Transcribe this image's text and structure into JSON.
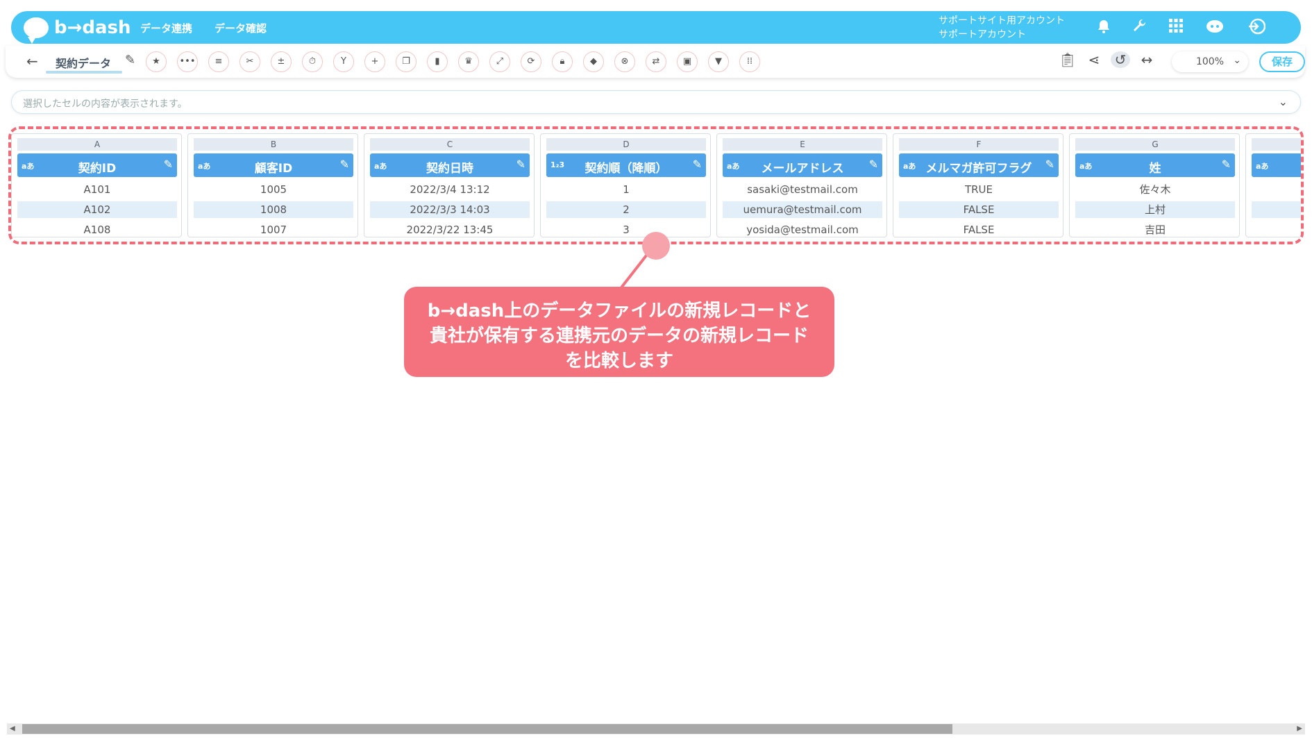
{
  "header": {
    "logo_text": "b→dash",
    "nav": [
      "データ連携",
      "データ確認"
    ],
    "account_line1": "サポートサイト用アカウント",
    "account_line2": "サポートアカウント",
    "icons": [
      "bell-icon",
      "wrench-icon",
      "apps-grid-icon",
      "assistant-icon",
      "logout-icon"
    ]
  },
  "toolbar": {
    "back_glyph": "←",
    "tab_name": "契約データ",
    "zoom": "100%",
    "save_label": "保存",
    "tool_icons": [
      "star-icon",
      "more-icon",
      "list-icon",
      "tools-icon",
      "cross-icon",
      "timer-icon",
      "merge-icon",
      "plus-icon",
      "copy-icon",
      "trash-icon",
      "crown-icon",
      "expand-icon",
      "repeat-icon",
      "lock-icon",
      "cube-icon",
      "close-circle-icon",
      "transform-icon",
      "frame-icon",
      "filter-icon",
      "grid-icon"
    ]
  },
  "formula_bar": {
    "placeholder": "選択したセルの内容が表示されます。"
  },
  "table": {
    "columns": [
      {
        "letter": "A",
        "type": "aあ",
        "title": "契約ID",
        "cells": [
          "A101",
          "A102",
          "A108"
        ]
      },
      {
        "letter": "B",
        "type": "aあ",
        "title": "顧客ID",
        "cells": [
          "1005",
          "1008",
          "1007"
        ]
      },
      {
        "letter": "C",
        "type": "aあ",
        "title": "契約日時",
        "cells": [
          "2022/3/4 13:12",
          "2022/3/3 14:03",
          "2022/3/22 13:45"
        ]
      },
      {
        "letter": "D",
        "type": "1₂3",
        "title": "契約順（降順）",
        "cells": [
          "1",
          "2",
          "3"
        ]
      },
      {
        "letter": "E",
        "type": "aあ",
        "title": "メールアドレス",
        "cells": [
          "sasaki@testmail.com",
          "uemura@testmail.com",
          "yosida@testmail.com"
        ]
      },
      {
        "letter": "F",
        "type": "aあ",
        "title": "メルマガ許可フラグ",
        "cells": [
          "TRUE",
          "FALSE",
          "FALSE"
        ]
      },
      {
        "letter": "G",
        "type": "aあ",
        "title": "姓",
        "cells": [
          "佐々木",
          "上村",
          "吉田"
        ]
      },
      {
        "letter": "",
        "type": "aあ",
        "title": "",
        "cells": [
          "",
          "",
          ""
        ]
      }
    ]
  },
  "callout": {
    "line1": "b→dash上のデータファイルの新規レコードと",
    "line2": "貴社が保有する連携元のデータの新規レコード",
    "line3": "を比較します"
  }
}
